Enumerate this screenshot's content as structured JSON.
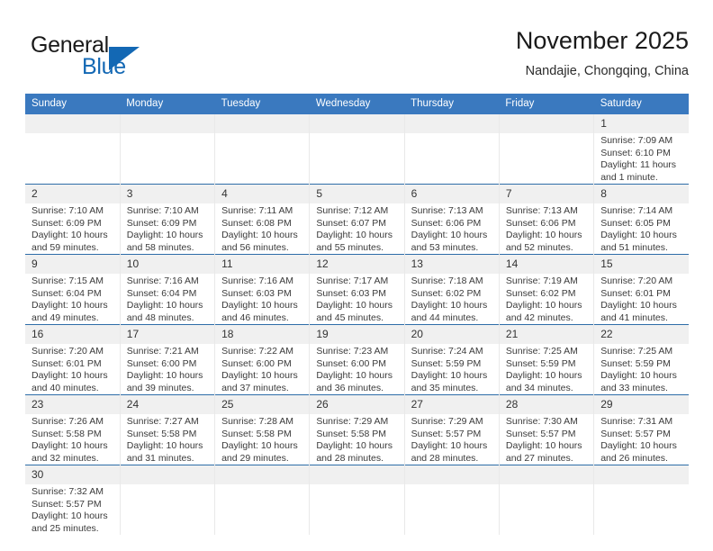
{
  "brand": {
    "name_part1": "General",
    "name_part2": "Blue",
    "colors": {
      "blue": "#1368b4",
      "header_blue": "#3a79bf",
      "row_rule": "#2e6da8",
      "daynum_bg": "#f0f0f0"
    }
  },
  "header": {
    "title": "November 2025",
    "subtitle": "Nandajie, Chongqing, China"
  },
  "weekdays": [
    "Sunday",
    "Monday",
    "Tuesday",
    "Wednesday",
    "Thursday",
    "Friday",
    "Saturday"
  ],
  "labels": {
    "sunrise": "Sunrise:",
    "sunset": "Sunset:",
    "daylight": "Daylight:"
  },
  "weeks": [
    [
      {
        "day": "",
        "empty": true
      },
      {
        "day": "",
        "empty": true
      },
      {
        "day": "",
        "empty": true
      },
      {
        "day": "",
        "empty": true
      },
      {
        "day": "",
        "empty": true
      },
      {
        "day": "",
        "empty": true
      },
      {
        "day": "1",
        "sunrise": "Sunrise: 7:09 AM",
        "sunset": "Sunset: 6:10 PM",
        "daylight1": "Daylight: 11 hours",
        "daylight2": "and 1 minute."
      }
    ],
    [
      {
        "day": "2",
        "sunrise": "Sunrise: 7:10 AM",
        "sunset": "Sunset: 6:09 PM",
        "daylight1": "Daylight: 10 hours",
        "daylight2": "and 59 minutes."
      },
      {
        "day": "3",
        "sunrise": "Sunrise: 7:10 AM",
        "sunset": "Sunset: 6:09 PM",
        "daylight1": "Daylight: 10 hours",
        "daylight2": "and 58 minutes."
      },
      {
        "day": "4",
        "sunrise": "Sunrise: 7:11 AM",
        "sunset": "Sunset: 6:08 PM",
        "daylight1": "Daylight: 10 hours",
        "daylight2": "and 56 minutes."
      },
      {
        "day": "5",
        "sunrise": "Sunrise: 7:12 AM",
        "sunset": "Sunset: 6:07 PM",
        "daylight1": "Daylight: 10 hours",
        "daylight2": "and 55 minutes."
      },
      {
        "day": "6",
        "sunrise": "Sunrise: 7:13 AM",
        "sunset": "Sunset: 6:06 PM",
        "daylight1": "Daylight: 10 hours",
        "daylight2": "and 53 minutes."
      },
      {
        "day": "7",
        "sunrise": "Sunrise: 7:13 AM",
        "sunset": "Sunset: 6:06 PM",
        "daylight1": "Daylight: 10 hours",
        "daylight2": "and 52 minutes."
      },
      {
        "day": "8",
        "sunrise": "Sunrise: 7:14 AM",
        "sunset": "Sunset: 6:05 PM",
        "daylight1": "Daylight: 10 hours",
        "daylight2": "and 51 minutes."
      }
    ],
    [
      {
        "day": "9",
        "sunrise": "Sunrise: 7:15 AM",
        "sunset": "Sunset: 6:04 PM",
        "daylight1": "Daylight: 10 hours",
        "daylight2": "and 49 minutes."
      },
      {
        "day": "10",
        "sunrise": "Sunrise: 7:16 AM",
        "sunset": "Sunset: 6:04 PM",
        "daylight1": "Daylight: 10 hours",
        "daylight2": "and 48 minutes."
      },
      {
        "day": "11",
        "sunrise": "Sunrise: 7:16 AM",
        "sunset": "Sunset: 6:03 PM",
        "daylight1": "Daylight: 10 hours",
        "daylight2": "and 46 minutes."
      },
      {
        "day": "12",
        "sunrise": "Sunrise: 7:17 AM",
        "sunset": "Sunset: 6:03 PM",
        "daylight1": "Daylight: 10 hours",
        "daylight2": "and 45 minutes."
      },
      {
        "day": "13",
        "sunrise": "Sunrise: 7:18 AM",
        "sunset": "Sunset: 6:02 PM",
        "daylight1": "Daylight: 10 hours",
        "daylight2": "and 44 minutes."
      },
      {
        "day": "14",
        "sunrise": "Sunrise: 7:19 AM",
        "sunset": "Sunset: 6:02 PM",
        "daylight1": "Daylight: 10 hours",
        "daylight2": "and 42 minutes."
      },
      {
        "day": "15",
        "sunrise": "Sunrise: 7:20 AM",
        "sunset": "Sunset: 6:01 PM",
        "daylight1": "Daylight: 10 hours",
        "daylight2": "and 41 minutes."
      }
    ],
    [
      {
        "day": "16",
        "sunrise": "Sunrise: 7:20 AM",
        "sunset": "Sunset: 6:01 PM",
        "daylight1": "Daylight: 10 hours",
        "daylight2": "and 40 minutes."
      },
      {
        "day": "17",
        "sunrise": "Sunrise: 7:21 AM",
        "sunset": "Sunset: 6:00 PM",
        "daylight1": "Daylight: 10 hours",
        "daylight2": "and 39 minutes."
      },
      {
        "day": "18",
        "sunrise": "Sunrise: 7:22 AM",
        "sunset": "Sunset: 6:00 PM",
        "daylight1": "Daylight: 10 hours",
        "daylight2": "and 37 minutes."
      },
      {
        "day": "19",
        "sunrise": "Sunrise: 7:23 AM",
        "sunset": "Sunset: 6:00 PM",
        "daylight1": "Daylight: 10 hours",
        "daylight2": "and 36 minutes."
      },
      {
        "day": "20",
        "sunrise": "Sunrise: 7:24 AM",
        "sunset": "Sunset: 5:59 PM",
        "daylight1": "Daylight: 10 hours",
        "daylight2": "and 35 minutes."
      },
      {
        "day": "21",
        "sunrise": "Sunrise: 7:25 AM",
        "sunset": "Sunset: 5:59 PM",
        "daylight1": "Daylight: 10 hours",
        "daylight2": "and 34 minutes."
      },
      {
        "day": "22",
        "sunrise": "Sunrise: 7:25 AM",
        "sunset": "Sunset: 5:59 PM",
        "daylight1": "Daylight: 10 hours",
        "daylight2": "and 33 minutes."
      }
    ],
    [
      {
        "day": "23",
        "sunrise": "Sunrise: 7:26 AM",
        "sunset": "Sunset: 5:58 PM",
        "daylight1": "Daylight: 10 hours",
        "daylight2": "and 32 minutes."
      },
      {
        "day": "24",
        "sunrise": "Sunrise: 7:27 AM",
        "sunset": "Sunset: 5:58 PM",
        "daylight1": "Daylight: 10 hours",
        "daylight2": "and 31 minutes."
      },
      {
        "day": "25",
        "sunrise": "Sunrise: 7:28 AM",
        "sunset": "Sunset: 5:58 PM",
        "daylight1": "Daylight: 10 hours",
        "daylight2": "and 29 minutes."
      },
      {
        "day": "26",
        "sunrise": "Sunrise: 7:29 AM",
        "sunset": "Sunset: 5:58 PM",
        "daylight1": "Daylight: 10 hours",
        "daylight2": "and 28 minutes."
      },
      {
        "day": "27",
        "sunrise": "Sunrise: 7:29 AM",
        "sunset": "Sunset: 5:57 PM",
        "daylight1": "Daylight: 10 hours",
        "daylight2": "and 28 minutes."
      },
      {
        "day": "28",
        "sunrise": "Sunrise: 7:30 AM",
        "sunset": "Sunset: 5:57 PM",
        "daylight1": "Daylight: 10 hours",
        "daylight2": "and 27 minutes."
      },
      {
        "day": "29",
        "sunrise": "Sunrise: 7:31 AM",
        "sunset": "Sunset: 5:57 PM",
        "daylight1": "Daylight: 10 hours",
        "daylight2": "and 26 minutes."
      }
    ],
    [
      {
        "day": "30",
        "sunrise": "Sunrise: 7:32 AM",
        "sunset": "Sunset: 5:57 PM",
        "daylight1": "Daylight: 10 hours",
        "daylight2": "and 25 minutes."
      },
      {
        "day": "",
        "empty": true
      },
      {
        "day": "",
        "empty": true
      },
      {
        "day": "",
        "empty": true
      },
      {
        "day": "",
        "empty": true
      },
      {
        "day": "",
        "empty": true
      },
      {
        "day": "",
        "empty": true
      }
    ]
  ]
}
